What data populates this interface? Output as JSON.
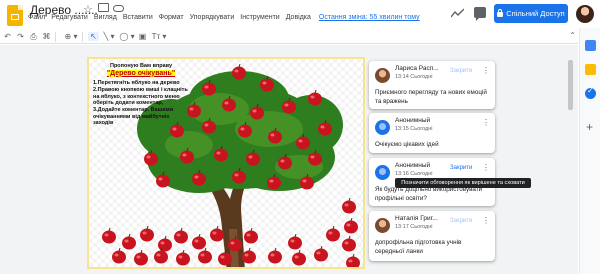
{
  "app": {
    "doc_title": "Дерево .......",
    "menu": [
      "Файл",
      "Редагувати",
      "Вигляд",
      "Вставити",
      "Формат",
      "Упорядкувати",
      "Інструменти",
      "Довідка"
    ],
    "last_edit": "Остання зміна: 55 хвилин тому",
    "share_label": "Спільний Доступ",
    "accent": "#1a73e8"
  },
  "toolbar": {
    "add": "+",
    "undo": "↶",
    "redo": "↷",
    "print": "⎙",
    "paint": "⌘",
    "zoom": "⊕ ▾",
    "select": "↖",
    "line": "╲ ▾",
    "shape": "◯ ▾",
    "image": "▣",
    "text_tool": "Tᴛ ▾",
    "collapse": "⌃"
  },
  "slide": {
    "intro": "Пропоную Вам вправу",
    "title": "\"Дерево очікувань\"",
    "steps": "1.Перетягніть яблуко на дерево\n2.Правою кнопкою миші і клацніть на яблуко, з контекстного меню оберіть додати коментар,\n3.Додайте коментар. Вашими очікуваннями від майбутніх заходів",
    "title_color": "#c00000",
    "highlight_color": "#ffff00"
  },
  "comments": [
    {
      "name": "Лариса Расп...",
      "time": "13:14 Сьогодні",
      "resolve": "Закрити",
      "body": "Приємного перегляду та нових емоцій та вражень",
      "avatar": "photo"
    },
    {
      "name": "Анонимный",
      "time": "13:15 Сьогодні",
      "resolve": "",
      "body": "Очікуємо цікавих ідей",
      "avatar": "default"
    },
    {
      "name": "Анонимный",
      "time": "13:16 Сьогодні",
      "resolve": "Закрити",
      "body": "Як будуть доцільно використовувати профільні освіти?",
      "avatar": "default"
    },
    {
      "name": "Наталія Григ...",
      "time": "13:17 Сьогодні",
      "resolve": "Закрити",
      "body": "допрофільна підготовка учнів середньої ланки",
      "avatar": "photo"
    }
  ],
  "tooltip": "Позначити обговорення як вирішене та сховати"
}
